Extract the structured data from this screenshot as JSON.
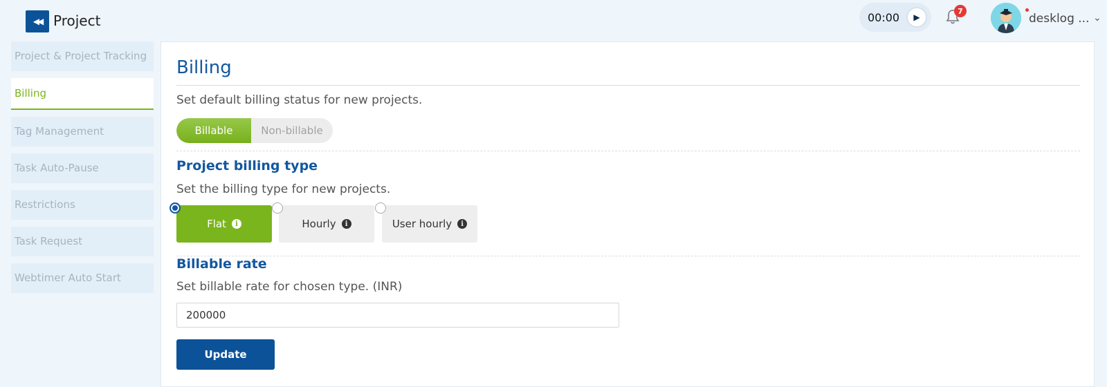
{
  "header": {
    "title": "Project",
    "timer": "00:00",
    "notification_count": "7",
    "user_name": "desklog ..."
  },
  "sidebar": {
    "items": [
      {
        "label": "Project & Project Tracking",
        "active": false
      },
      {
        "label": "Billing",
        "active": true
      },
      {
        "label": "Tag Management",
        "active": false
      },
      {
        "label": "Task Auto-Pause",
        "active": false
      },
      {
        "label": "Restrictions",
        "active": false
      },
      {
        "label": "Task Request",
        "active": false
      },
      {
        "label": "Webtimer Auto Start",
        "active": false
      }
    ]
  },
  "billing": {
    "title": "Billing",
    "default_status_desc": "Set default billing status for new projects.",
    "toggle": {
      "billable": "Billable",
      "non_billable": "Non-billable",
      "selected": "Billable"
    },
    "type_section": {
      "title": "Project billing type",
      "desc": "Set the billing type for new projects.",
      "options": [
        {
          "label": "Flat",
          "selected": true
        },
        {
          "label": "Hourly",
          "selected": false
        },
        {
          "label": "User hourly",
          "selected": false
        }
      ]
    },
    "rate_section": {
      "title": "Billable rate",
      "desc": "Set billable rate for chosen type. (INR)",
      "value": "200000"
    },
    "update_label": "Update"
  },
  "colors": {
    "brand_blue": "#0c5299",
    "accent_green": "#7ab51d",
    "heading_blue": "#1357a0",
    "badge_red": "#e53935"
  },
  "icons": [
    "double-arrow-left-icon",
    "play-icon",
    "bell-icon",
    "info-icon",
    "chevron-down-icon"
  ]
}
